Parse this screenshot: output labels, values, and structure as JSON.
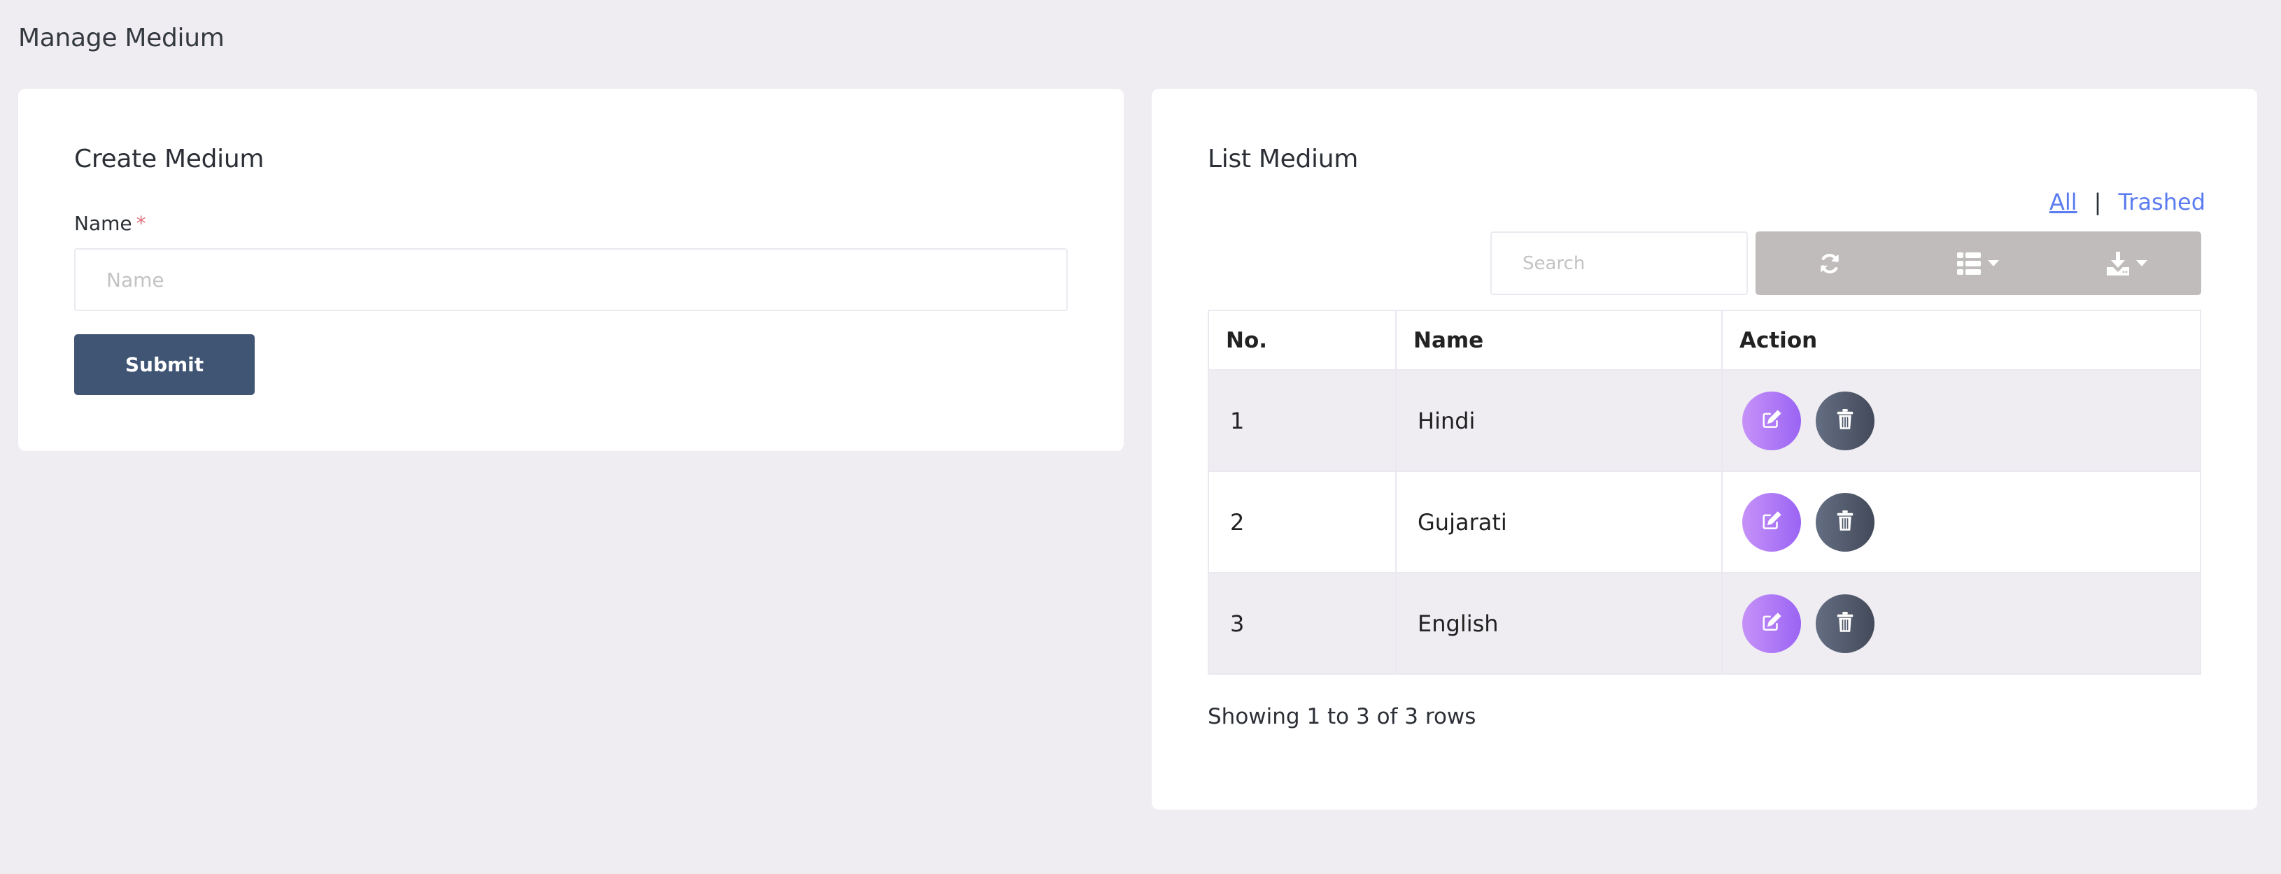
{
  "page": {
    "title": "Manage Medium"
  },
  "create_form": {
    "title": "Create Medium",
    "name_label": "Name",
    "required_marker": "*",
    "name_value": "",
    "name_placeholder": "Name",
    "submit_label": "Submit",
    "submit_color": "#405574"
  },
  "list": {
    "title": "List Medium",
    "filters": [
      {
        "label": "All",
        "active": true
      },
      {
        "label": "Trashed",
        "active": false
      }
    ],
    "filter_separator": "|",
    "search_placeholder": "Search",
    "search_value": "",
    "toolbar": [
      {
        "name": "refresh",
        "icon": "refresh-icon"
      },
      {
        "name": "columns",
        "icon": "list-icon",
        "dropdown": true
      },
      {
        "name": "export",
        "icon": "download-icon",
        "dropdown": true
      }
    ],
    "columns": [
      "No.",
      "Name",
      "Action"
    ],
    "rows": [
      {
        "no": "1",
        "name": "Hindi"
      },
      {
        "no": "2",
        "name": "Gujarati"
      },
      {
        "no": "3",
        "name": "English"
      }
    ],
    "row_actions": [
      {
        "name": "edit",
        "icon": "edit-icon"
      },
      {
        "name": "delete",
        "icon": "trash-icon"
      }
    ],
    "footer": "Showing 1 to 3 of 3 rows"
  },
  "colors": {
    "background": "#efedf2",
    "link": "#5b7cf0",
    "toolbar": "#c0bcbb",
    "edit_gradient": [
      "#c692f8",
      "#9a64f4"
    ],
    "delete_gradient": [
      "#646e82",
      "#434a5a"
    ],
    "required": "#e0707e"
  }
}
